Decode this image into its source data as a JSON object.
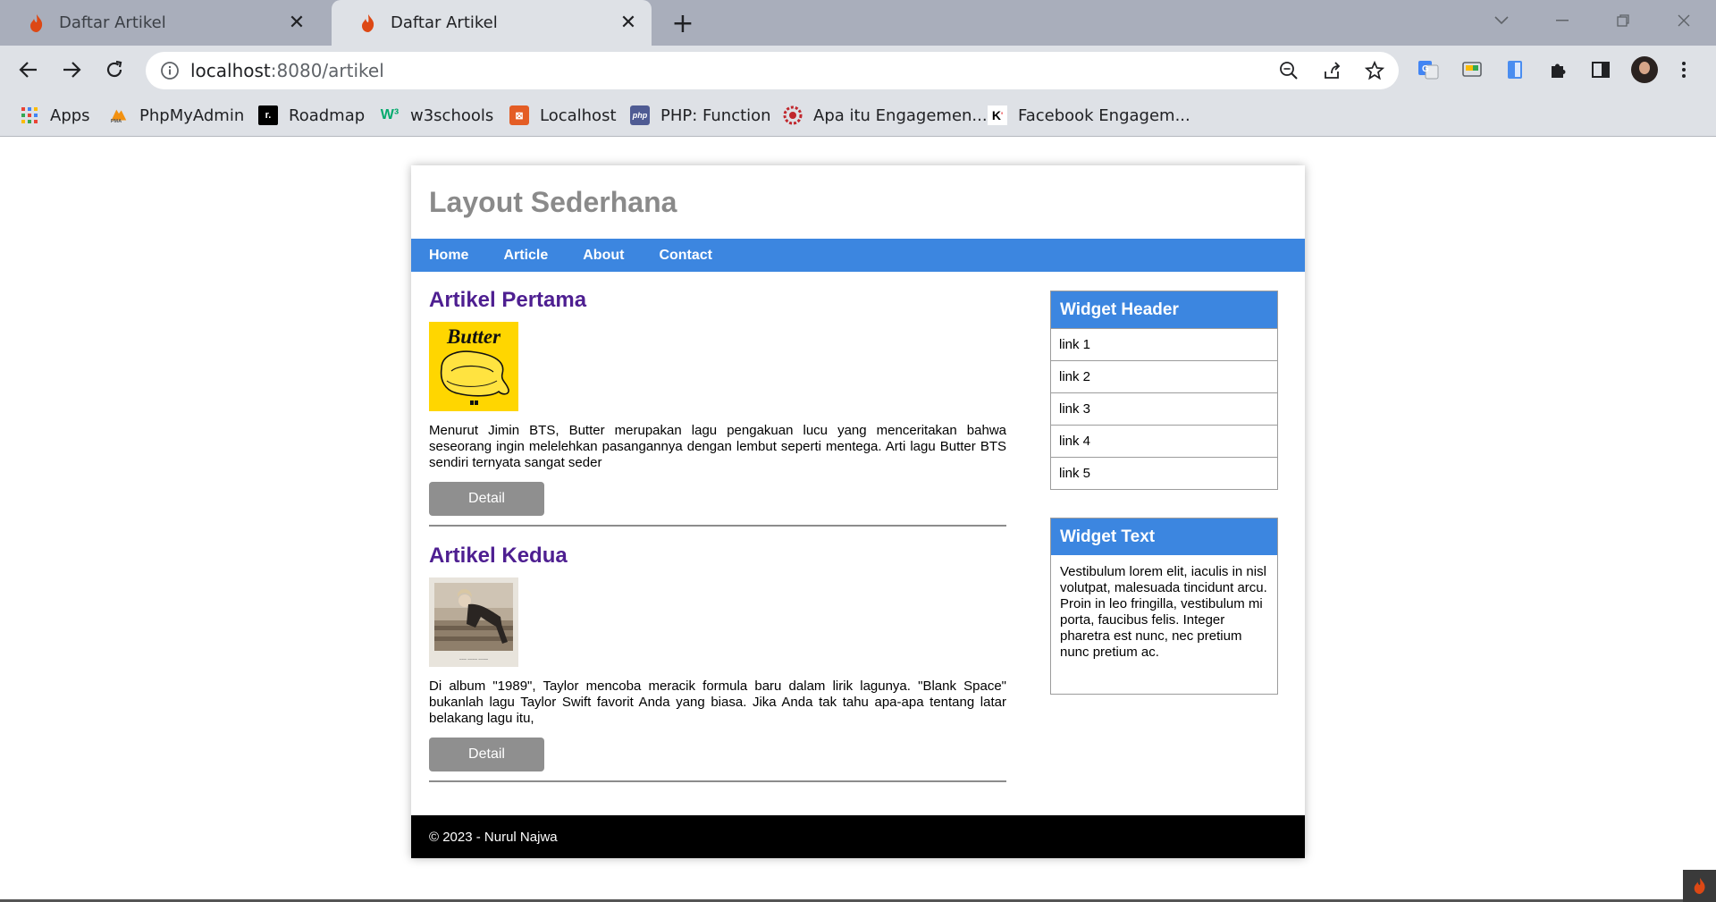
{
  "browser": {
    "tabs": [
      {
        "title": "Daftar Artikel",
        "active": false
      },
      {
        "title": "Daftar Artikel",
        "active": true
      }
    ],
    "address": {
      "host": "localhost",
      "path": ":8080/artikel"
    },
    "bookmarks": [
      {
        "label": "Apps",
        "icon": "apps-grid-icon"
      },
      {
        "label": "PhpMyAdmin",
        "icon": "phpmyadmin-icon"
      },
      {
        "label": "Roadmap",
        "icon": "roadmap-icon"
      },
      {
        "label": "w3schools",
        "icon": "w3schools-icon"
      },
      {
        "label": "Localhost",
        "icon": "codeigniter-icon"
      },
      {
        "label": "PHP: Function",
        "icon": "php-icon"
      },
      {
        "label": "Apa itu Engagemen...",
        "icon": "engagement-icon"
      },
      {
        "label": "Facebook Engagem...",
        "icon": "klipfolio-icon"
      }
    ]
  },
  "page": {
    "title": "Layout Sederhana",
    "nav": [
      "Home",
      "Article",
      "About",
      "Contact"
    ],
    "articles": [
      {
        "title": "Artikel Pertama",
        "image_text": "Butter",
        "body": "Menurut Jimin BTS, Butter merupakan lagu pengakuan lucu yang menceritakan bahwa seseorang ingin melelehkan pasangannya dengan lembut seperti mentega. Arti lagu Butter BTS sendiri ternyata sangat seder",
        "button": "Detail"
      },
      {
        "title": "Artikel Kedua",
        "body": "Di album \"1989\", Taylor mencoba meracik formula baru dalam lirik lagunya. \"Blank Space\" bukanlah lagu Taylor Swift favorit Anda yang biasa. Jika Anda tak tahu apa-apa tentang latar belakang lagu itu,",
        "button": "Detail"
      }
    ],
    "widget_links": {
      "header": "Widget Header",
      "links": [
        "link 1",
        "link 2",
        "link 3",
        "link 4",
        "link 5"
      ]
    },
    "widget_text": {
      "header": "Widget Text",
      "body": "Vestibulum lorem elit, iaculis in nisl volutpat, malesuada tincidunt arcu. Proin in leo fringilla, vestibulum mi porta, faucibus felis. Integer pharetra est nunc, nec pretium nunc pretium ac."
    },
    "footer": "© 2023 - Nurul Najwa"
  },
  "colors": {
    "nav_blue": "#3c86e0",
    "article_title": "#4e1f91",
    "button_gray": "#8f8f8f",
    "footer_black": "#000000"
  }
}
